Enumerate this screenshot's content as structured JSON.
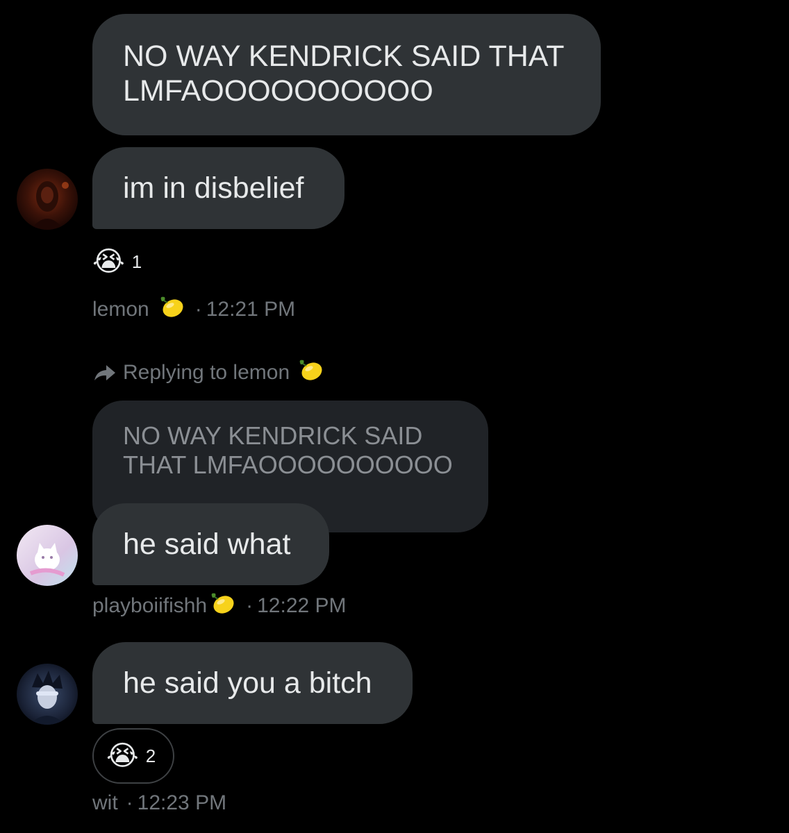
{
  "messages": [
    {
      "text": "NO WAY KENDRICK SAID THAT\nLMFAOOOOOOOOOO"
    },
    {
      "text": "im in disbelief",
      "reaction": {
        "emoji": "😭",
        "count": "1"
      },
      "sender": "lemon",
      "time": "12:21 PM"
    },
    {
      "replying_to": "Replying to lemon",
      "quoted_text": "NO WAY KENDRICK SAID\nTHAT LMFAOOOOOOOOOO",
      "text": "he said what",
      "sender": "playboiifishh",
      "time": "12:22 PM"
    },
    {
      "text": "he said you a bitch",
      "reaction": {
        "emoji": "😭",
        "count": "2"
      },
      "sender": "wit",
      "time": "12:23 PM"
    }
  ],
  "colors": {
    "background": "#000000",
    "bubble": "#2f3336",
    "text": "#e7e9ea",
    "muted": "#71767b"
  },
  "icons": {
    "lemon": "lemon-icon",
    "reply": "reply-arrow-icon",
    "crying": "loudly-crying-face-emoji"
  }
}
